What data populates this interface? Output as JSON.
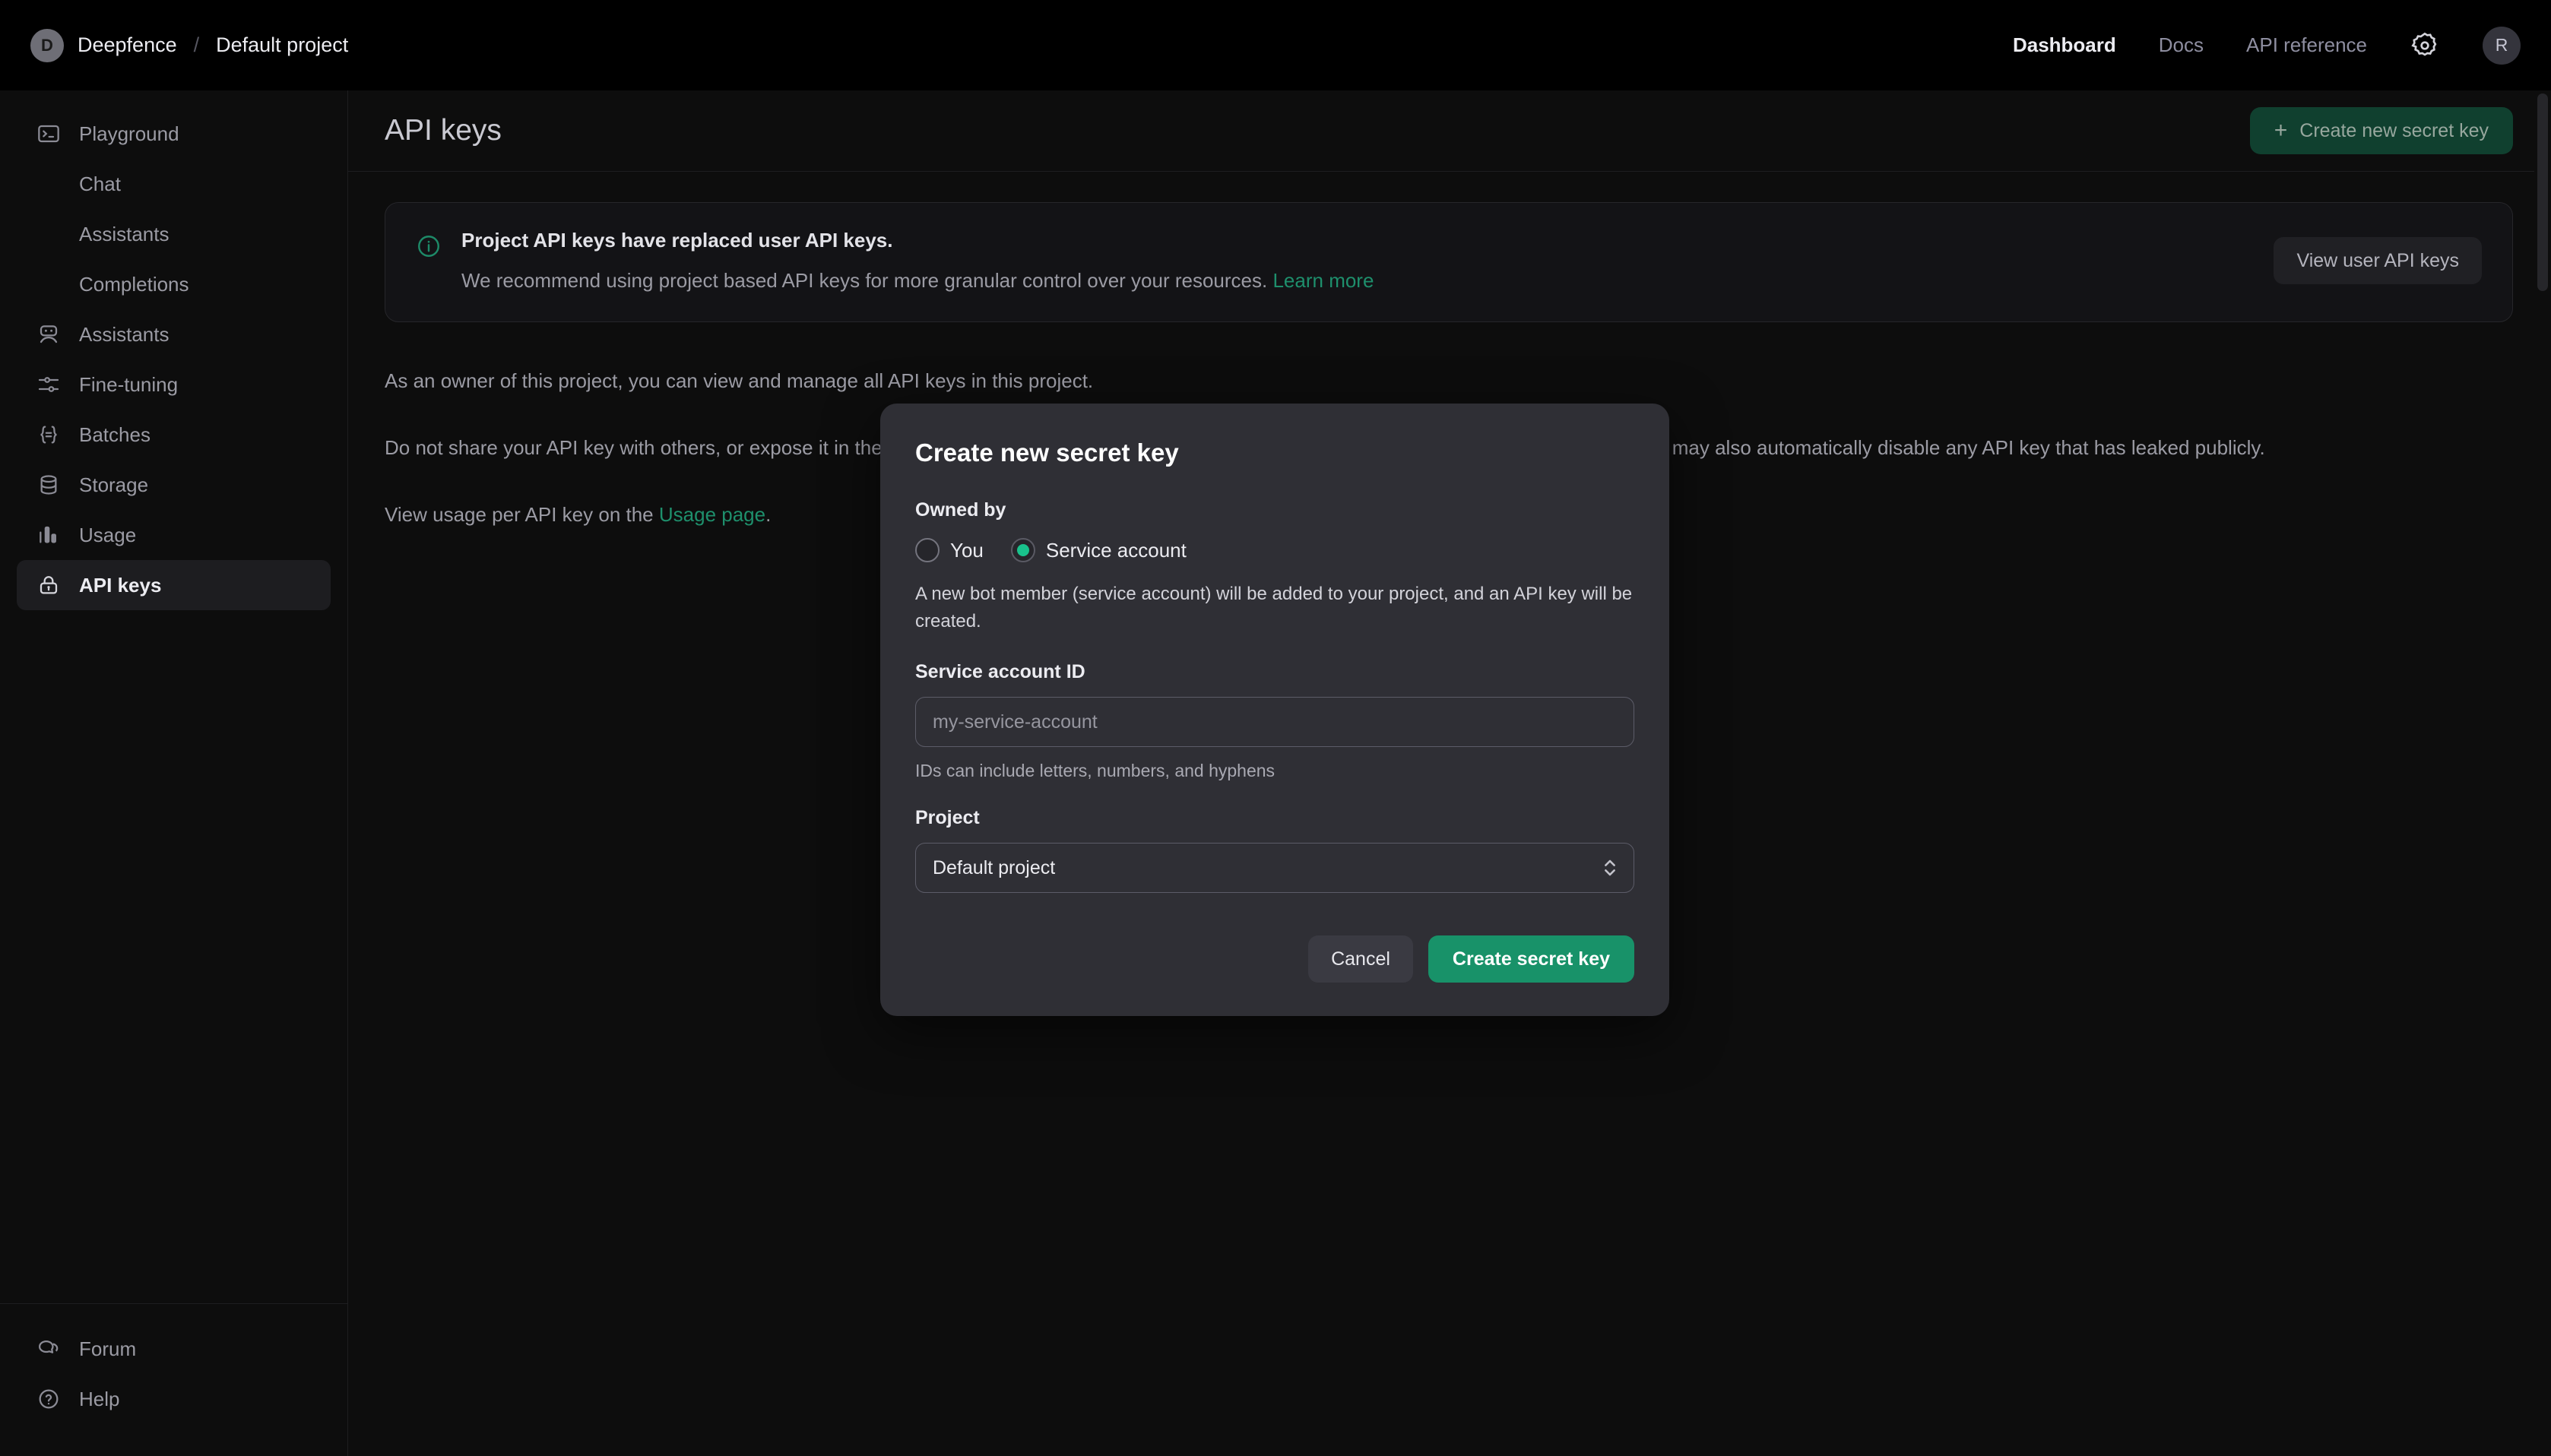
{
  "topbar": {
    "avatar_initial": "D",
    "org_name": "Deepfence",
    "separator": "/",
    "project_name": "Default project",
    "nav": [
      {
        "label": "Dashboard",
        "active": true
      },
      {
        "label": "Docs",
        "active": false
      },
      {
        "label": "API reference",
        "active": false
      }
    ],
    "settings_icon": "gear-icon",
    "user_initial": "R"
  },
  "sidebar": {
    "items": [
      {
        "label": "Playground",
        "icon": "terminal-icon",
        "sub": false,
        "active": false
      },
      {
        "label": "Chat",
        "icon": "",
        "sub": true,
        "active": false
      },
      {
        "label": "Assistants",
        "icon": "",
        "sub": true,
        "active": false
      },
      {
        "label": "Completions",
        "icon": "",
        "sub": true,
        "active": false
      },
      {
        "label": "Assistants",
        "icon": "robot-icon",
        "sub": false,
        "active": false
      },
      {
        "label": "Fine-tuning",
        "icon": "sliders-icon",
        "sub": false,
        "active": false
      },
      {
        "label": "Batches",
        "icon": "braces-icon",
        "sub": false,
        "active": false
      },
      {
        "label": "Storage",
        "icon": "database-icon",
        "sub": false,
        "active": false
      },
      {
        "label": "Usage",
        "icon": "bar-chart-icon",
        "sub": false,
        "active": false
      },
      {
        "label": "API keys",
        "icon": "lock-icon",
        "sub": false,
        "active": true
      }
    ],
    "bottom_items": [
      {
        "label": "Forum",
        "icon": "chat-bubbles-icon"
      },
      {
        "label": "Help",
        "icon": "question-circle-icon"
      }
    ]
  },
  "main": {
    "page_title": "API keys",
    "create_button": {
      "label": "Create new secret key",
      "plus": "+"
    },
    "banner": {
      "icon": "info-circle-icon",
      "title": "Project API keys have replaced user API keys.",
      "subtitle": "We recommend using project based API keys for more granular control over your resources.",
      "link_label": "Learn more",
      "action_label": "View user API keys"
    },
    "paragraphs": [
      "As an owner of this project, you can view and manage all API keys in this project.",
      "Do not share your API key with others, or expose it in the browser or other client-side code. In order to protect the security of your account, OpenAI may also automatically disable any API key that has leaked publicly.",
      "View usage per API key on the Usage page."
    ],
    "paragraph3_prefix": "View usage per API key on the ",
    "paragraph3_link": "Usage page",
    "paragraph3_suffix": "."
  },
  "modal": {
    "title": "Create new secret key",
    "owned_by_label": "Owned by",
    "options": [
      {
        "label": "You",
        "selected": false
      },
      {
        "label": "Service account",
        "selected": true
      }
    ],
    "helper_text": "A new bot member (service account) will be added to your project, and an API key will be created.",
    "service_account_id_label": "Service account ID",
    "service_account_id_value": "",
    "service_account_id_placeholder": "my-service-account",
    "service_account_id_hint": "IDs can include letters, numbers, and hyphens",
    "project_label": "Project",
    "project_selected": "Default project",
    "project_options": [
      "Default project"
    ],
    "cancel_label": "Cancel",
    "submit_label": "Create secret key"
  },
  "colors": {
    "page_bg": "#0d0d0d",
    "topbar_bg": "#000000",
    "modal_bg": "#2f2f35",
    "accent_green": "#189269",
    "radio_green": "#19c28c",
    "link_green": "#1e8f6c",
    "create_button_bg": "#10402f"
  }
}
